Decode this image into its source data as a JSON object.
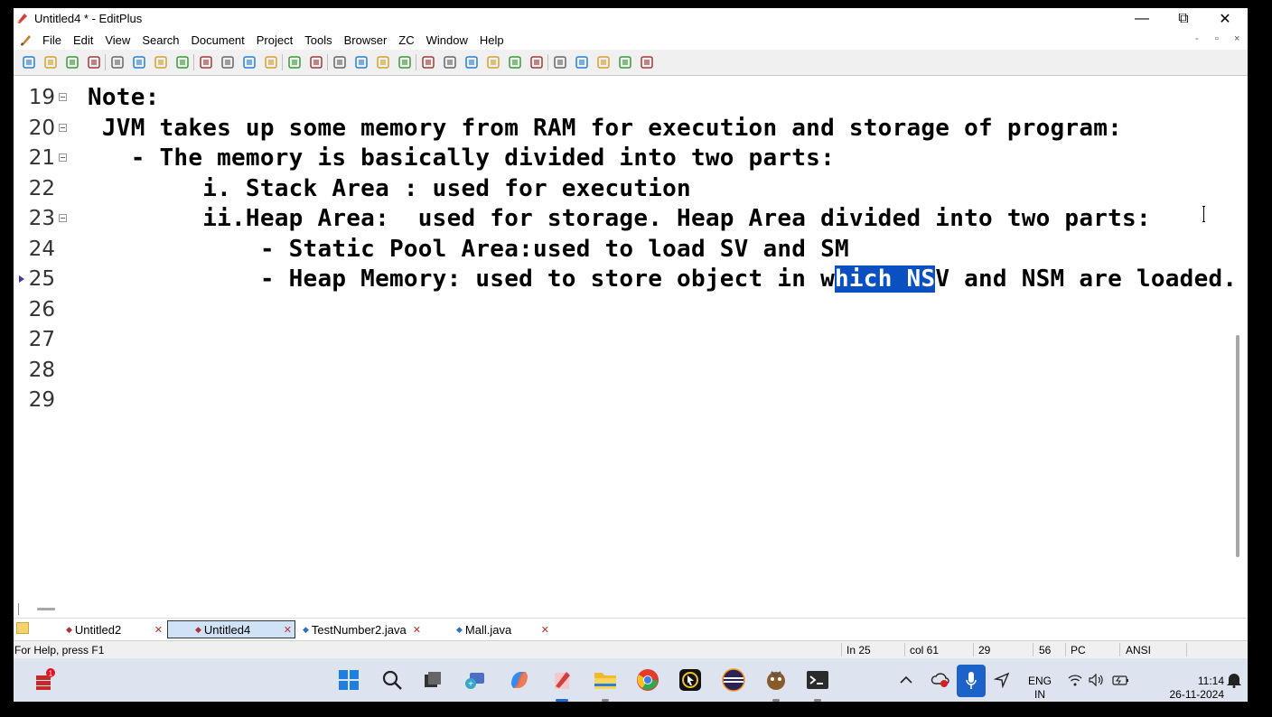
{
  "window": {
    "title": "Untitled4 * - EditPlus",
    "minimize_glyph": "—",
    "restore_glyph": "⧉",
    "close_glyph": "✕"
  },
  "menu": [
    "File",
    "Edit",
    "View",
    "Search",
    "Document",
    "Project",
    "Tools",
    "Browser",
    "ZC",
    "Window",
    "Help"
  ],
  "mdi_controls": [
    "-",
    "▫",
    "×"
  ],
  "toolbar_icons": [
    "new-file-icon",
    "open-folder-icon",
    "save-icon",
    "save-all-icon",
    "print-preview-icon",
    "print-icon",
    "spell-check-icon",
    "html-toolbar-icon",
    "cut-icon",
    "copy-icon",
    "paste-icon",
    "delete-icon",
    "undo-icon",
    "redo-icon",
    "find-icon",
    "replace-icon",
    "goto-icon",
    "indent-icon",
    "font-icon",
    "hex-icon",
    "word-wrap-icon",
    "line-number-icon",
    "ruler-icon",
    "check-icon",
    "doc-selector-icon",
    "cliptext-icon",
    "browser-icon",
    "output-icon",
    "help-icon"
  ],
  "editor": {
    "lines": [
      {
        "num": "19",
        "fold": true,
        "text": "Note:"
      },
      {
        "num": "20",
        "fold": true,
        "text": " JVM takes up some memory from RAM for execution and storage of program:"
      },
      {
        "num": "21",
        "fold": true,
        "text": "   - The memory is basically divided into two parts:"
      },
      {
        "num": "22",
        "fold": false,
        "text": "        i. Stack Area : used for execution"
      },
      {
        "num": "23",
        "fold": true,
        "text": "        ii.Heap Area:  used for storage. Heap Area divided into two parts:"
      },
      {
        "num": "24",
        "fold": false,
        "text": "            - Static Pool Area:used to load SV and SM"
      },
      {
        "num": "25",
        "fold": false,
        "bookmark": true,
        "pre": "            - Heap Memory: used to store object in w",
        "sel": "hich NS",
        "post": "V and NSM are loaded."
      },
      {
        "num": "26",
        "fold": false,
        "text": ""
      },
      {
        "num": "27",
        "fold": false,
        "text": ""
      },
      {
        "num": "28",
        "fold": false,
        "text": ""
      },
      {
        "num": "29",
        "fold": false,
        "text": ""
      }
    ]
  },
  "tabs": [
    {
      "label": "Untitled2",
      "active": false
    },
    {
      "label": "Untitled4",
      "active": true
    },
    {
      "label": "TestNumber2.java",
      "active": false
    },
    {
      "label": "Mall.java",
      "active": false
    }
  ],
  "status": {
    "help": "For Help, press F1",
    "line": "In 25",
    "col": "col 61",
    "total_lines": "29",
    "chars": "56",
    "format": "PC",
    "encoding": "ANSI"
  },
  "taskbar": {
    "badge": "1",
    "apps": [
      "start-icon",
      "search-icon",
      "task-view-icon",
      "teams-chat-icon",
      "copilot-icon",
      "editplus-taskbar-icon",
      "file-explorer-icon",
      "chrome-icon",
      "pointer-app-icon",
      "eclipse-icon",
      "game-app-icon",
      "terminal-icon"
    ],
    "lang_line1": "ENG",
    "lang_line2": "IN",
    "time": "11:14",
    "date": "26-11-2024"
  },
  "colors": {
    "selection": "#0a50c0",
    "taskbar": "#dde4ef",
    "active_tab": "#cfe2f6"
  }
}
